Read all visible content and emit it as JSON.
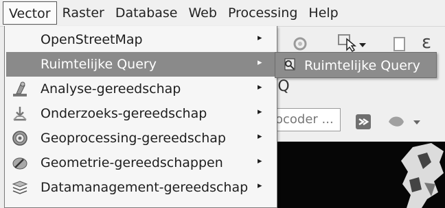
{
  "menubar": {
    "items": [
      {
        "label": "Vector"
      },
      {
        "label": "Raster"
      },
      {
        "label": "Database"
      },
      {
        "label": "Web"
      },
      {
        "label": "Processing"
      },
      {
        "label": "Help"
      }
    ]
  },
  "vector_menu": {
    "items": [
      {
        "label": "OpenStreetMap",
        "icon": "none"
      },
      {
        "label": "Ruimtelijke Query",
        "icon": "none",
        "highlighted": true
      },
      {
        "label": "Analyse-gereedschap",
        "icon": "analysis-icon"
      },
      {
        "label": "Onderzoeks-gereedschap",
        "icon": "research-icon"
      },
      {
        "label": "Geoprocessing-gereedschap",
        "icon": "geoprocessing-icon"
      },
      {
        "label": "Geometrie-gereedschappen",
        "icon": "geometry-icon"
      },
      {
        "label": "Datamanagement-gereedschap",
        "icon": "data-management-icon"
      }
    ],
    "submenu_arrow": "▸"
  },
  "submenu": {
    "label": "Ruimtelijke Query",
    "icon": "spatial-query-icon"
  },
  "toolbar": {
    "geocoder_text": "ocoder ...",
    "extra_glyph": "Q",
    "epsilon_glyph": "ε"
  },
  "colors": {
    "highlight": "#8a8a8a",
    "menu_bg": "#f6f6f6",
    "map_bg": "#060606"
  }
}
